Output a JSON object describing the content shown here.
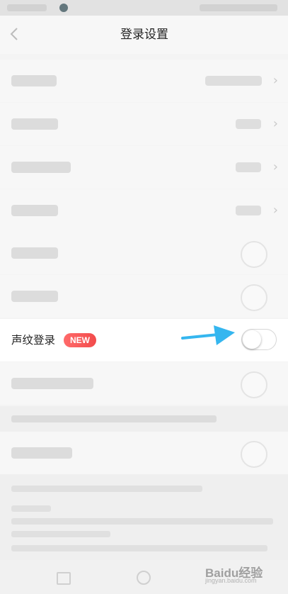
{
  "header": {
    "title": "登录设置",
    "back_icon": "chevron-left-icon"
  },
  "voiceprint_row": {
    "label": "声纹登录",
    "badge": "NEW",
    "toggle_state": "off"
  },
  "colors": {
    "badge": "#f24b4b",
    "arrow": "#35b6ef",
    "background": "#f4f4f4"
  },
  "watermark": {
    "text": "Baidu经验",
    "sub": "jingyan.baidu.com"
  }
}
